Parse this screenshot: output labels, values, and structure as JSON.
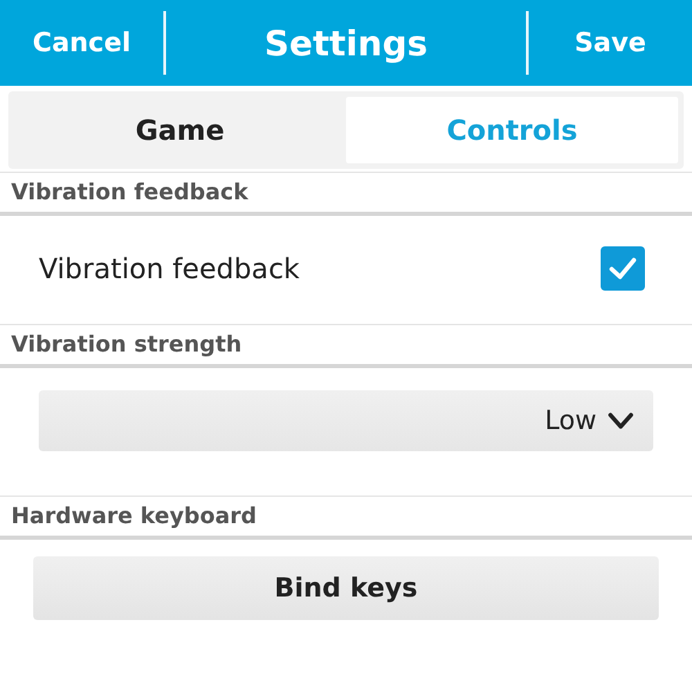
{
  "title_bar": {
    "cancel": "Cancel",
    "title": "Settings",
    "save": "Save"
  },
  "tabs": [
    {
      "label": "Game",
      "selected": false
    },
    {
      "label": "Controls",
      "selected": true
    }
  ],
  "sections": [
    {
      "header": "Vibration feedback",
      "kind": "checkbox",
      "label": "Vibration feedback",
      "checked": true
    },
    {
      "header": "Vibration strength",
      "kind": "dropdown",
      "value": "Low"
    },
    {
      "header": "Hardware keyboard",
      "kind": "button",
      "label": "Bind keys"
    }
  ]
}
